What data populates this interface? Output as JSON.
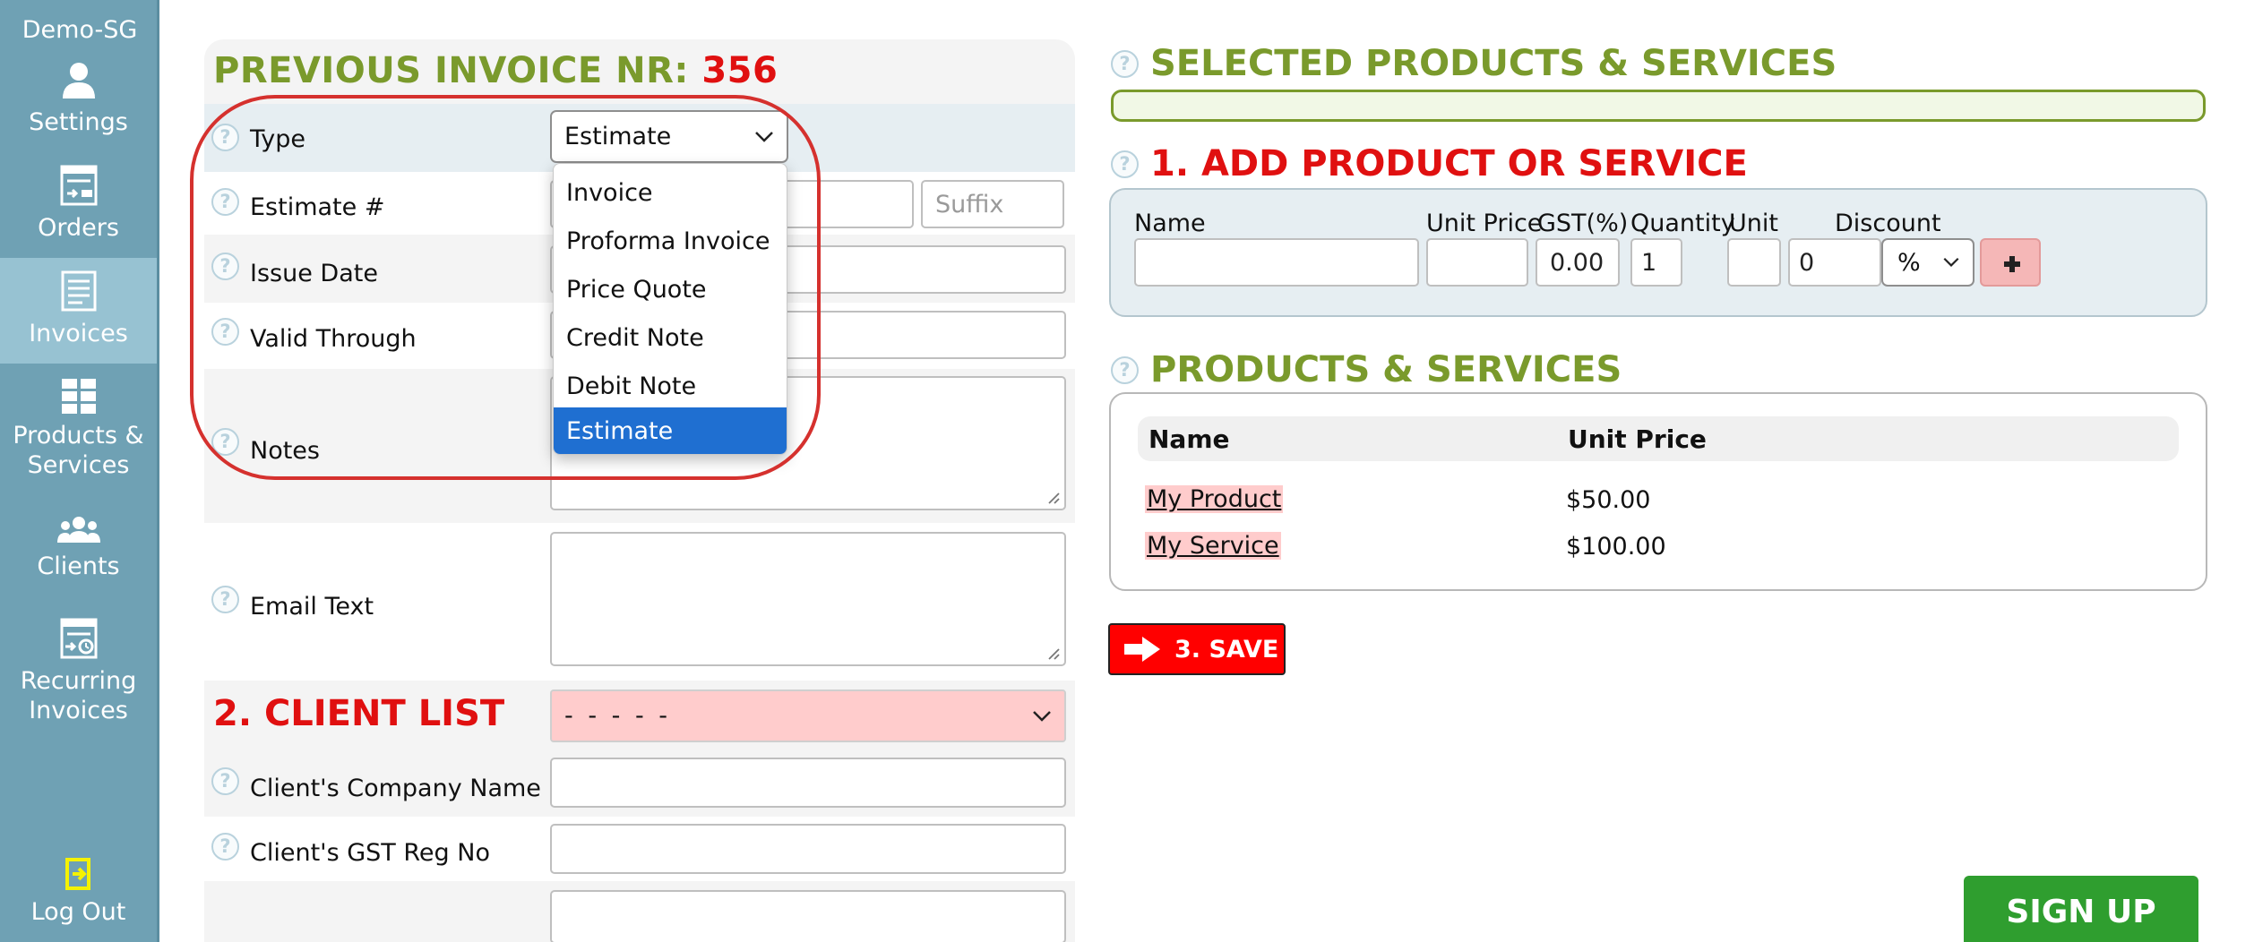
{
  "sidebar": {
    "brand": "Demo-SG",
    "items": [
      {
        "label": "Settings",
        "icon": "user-icon"
      },
      {
        "label": "Orders",
        "icon": "orders-icon"
      },
      {
        "label": "Invoices",
        "icon": "invoice-icon"
      },
      {
        "label_line1": "Products &",
        "label_line2": "Services",
        "icon": "grid-icon"
      },
      {
        "label": "Clients",
        "icon": "clients-icon"
      },
      {
        "label_line1": "Recurring",
        "label_line2": "Invoices",
        "icon": "recurring-icon"
      },
      {
        "label": "Log Out",
        "icon": "logout-icon"
      }
    ]
  },
  "form": {
    "prev_invoice_label": "PREVIOUS INVOICE NR:",
    "prev_invoice_number": "356",
    "type_label": "Type",
    "type_value": "Estimate",
    "estimate_label": "Estimate #",
    "suffix_placeholder": "Suffix",
    "issue_date_label": "Issue Date",
    "valid_through_label": "Valid Through",
    "notes_label": "Notes",
    "email_text_label": "Email Text",
    "client_list_title": "2. CLIENT LIST",
    "client_select_value": "- - - - -",
    "client_company_label": "Client's Company Name",
    "client_gst_label": "Client's GST Reg No",
    "help_glyph": "?"
  },
  "type_dropdown": {
    "options": [
      "Invoice",
      "Proforma Invoice",
      "Price Quote",
      "Credit Note",
      "Debit Note",
      "Estimate"
    ],
    "selected": "Estimate"
  },
  "selected_products": {
    "title": "SELECTED PRODUCTS & SERVICES"
  },
  "add_product": {
    "title": "1. ADD PRODUCT OR SERVICE",
    "col_name": "Name",
    "col_unit_price": "Unit Price",
    "col_gst": "GST(%)",
    "col_quantity": "Quantity",
    "col_unit": "Unit",
    "col_discount": "Discount",
    "gst_value": "0.00",
    "quantity_value": "1",
    "discount_value": "0",
    "discount_type": "%"
  },
  "products": {
    "title": "PRODUCTS & SERVICES",
    "col_name": "Name",
    "col_unit_price": "Unit Price",
    "rows": [
      {
        "name": "My Product",
        "price": "$50.00"
      },
      {
        "name": "My Service",
        "price": "$100.00"
      }
    ]
  },
  "actions": {
    "save_label": "3. SAVE",
    "signup_label": "SIGN UP"
  },
  "colors": {
    "sidebar": "#6fa1b4",
    "title_green": "#7a9a2c",
    "title_red": "#e01010",
    "highlight_pink": "#ffcccc",
    "selected_blue": "#1f6fd1",
    "signup_green": "#2f9e2f"
  }
}
